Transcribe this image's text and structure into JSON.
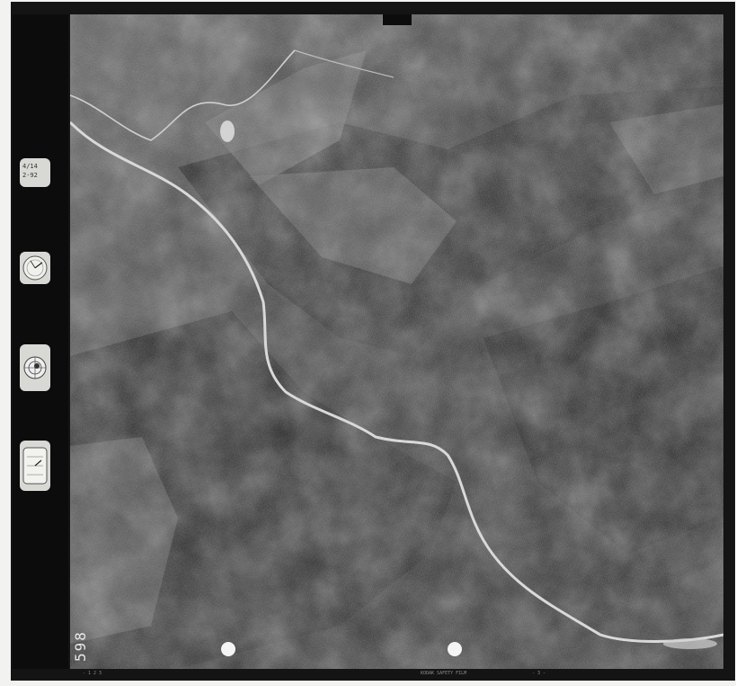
{
  "image": {
    "subject": "aerial photograph",
    "frame_number": "598",
    "footer_left": "- 1 2 3",
    "footer_center": "KODAK SAFETY FILM",
    "footer_right": "- 3 -"
  },
  "instruments": {
    "data_card": "4/14\n2-92",
    "altimeter": "",
    "level": "",
    "watch": ""
  },
  "colors": {
    "film_border": "#141414",
    "terrain_dark": "#1e1e1e",
    "terrain_mid": "#4a4a4a",
    "river": "#d9d9d9"
  }
}
